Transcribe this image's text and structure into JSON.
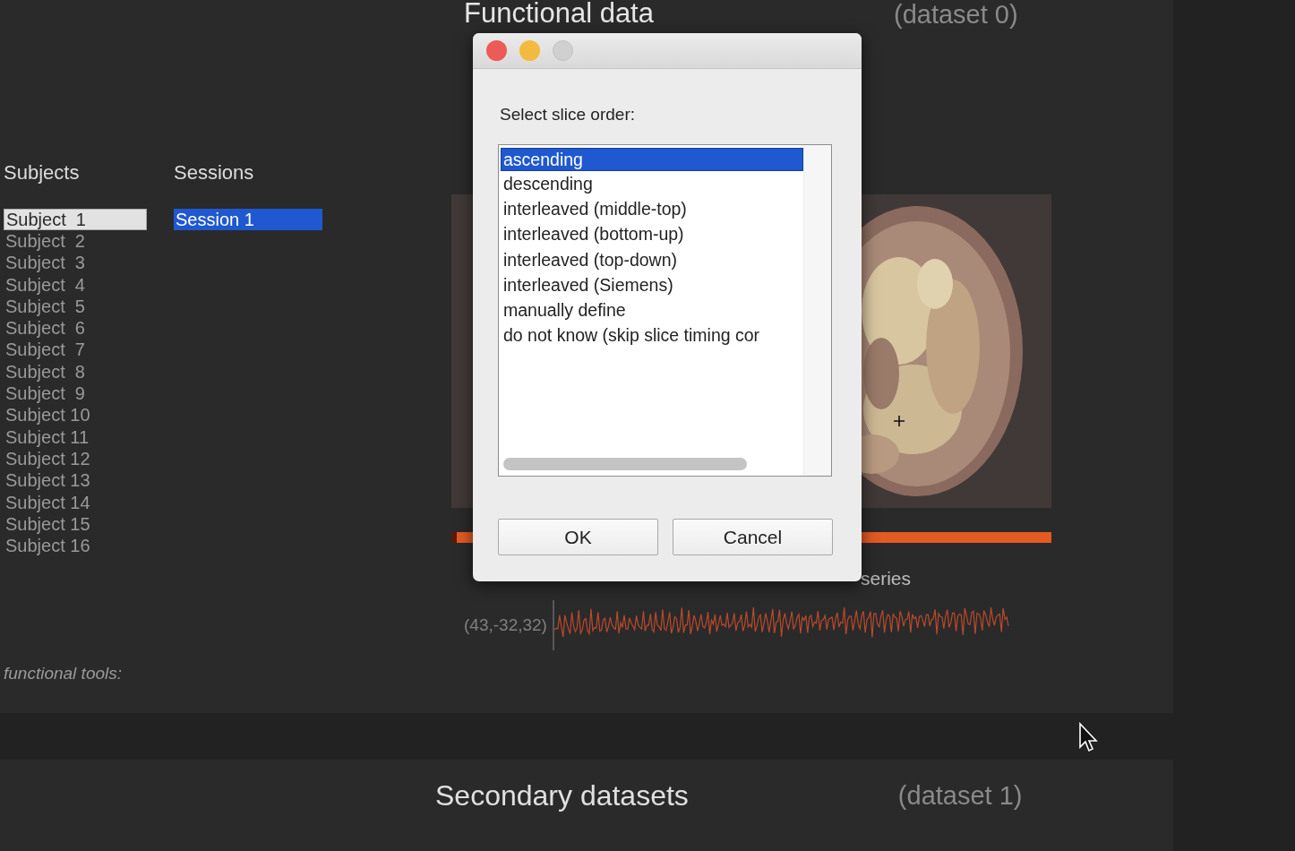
{
  "main_panel": {
    "title": "Functional data",
    "dataset": "(dataset 0)",
    "subjects": {
      "heading": "Subjects",
      "items": [
        {
          "label": "Subject  1",
          "selected": true
        },
        {
          "label": "Subject  2",
          "selected": false
        },
        {
          "label": "Subject  3",
          "selected": false
        },
        {
          "label": "Subject  4",
          "selected": false
        },
        {
          "label": "Subject  5",
          "selected": false
        },
        {
          "label": "Subject  6",
          "selected": false
        },
        {
          "label": "Subject  7",
          "selected": false
        },
        {
          "label": "Subject  8",
          "selected": false
        },
        {
          "label": "Subject  9",
          "selected": false
        },
        {
          "label": "Subject 10",
          "selected": false
        },
        {
          "label": "Subject 11",
          "selected": false
        },
        {
          "label": "Subject 12",
          "selected": false
        },
        {
          "label": "Subject 13",
          "selected": false
        },
        {
          "label": "Subject 14",
          "selected": false
        },
        {
          "label": "Subject 15",
          "selected": false
        },
        {
          "label": "Subject 16",
          "selected": false
        }
      ]
    },
    "sessions": {
      "heading": "Sessions",
      "items": [
        {
          "label": "Session 1",
          "selected": true
        }
      ]
    },
    "tools_label": "functional tools:",
    "viewer": {
      "timeseries_title": "series",
      "coordinates": "(43,-32,32)"
    }
  },
  "dialog": {
    "window_controls": [
      {
        "kind": "close",
        "disabled": false
      },
      {
        "kind": "minimize",
        "disabled": false
      },
      {
        "kind": "zoom",
        "disabled": true
      }
    ],
    "prompt": "Select slice order:",
    "options": [
      {
        "label": "ascending",
        "selected": true
      },
      {
        "label": "descending",
        "selected": false
      },
      {
        "label": "interleaved (middle-top)",
        "selected": false
      },
      {
        "label": "interleaved (bottom-up)",
        "selected": false
      },
      {
        "label": "interleaved (top-down)",
        "selected": false
      },
      {
        "label": "interleaved (Siemens)",
        "selected": false
      },
      {
        "label": "manually define",
        "selected": false
      },
      {
        "label": "do not know (skip slice timing cor",
        "selected": false
      }
    ],
    "buttons": [
      "OK",
      "Cancel"
    ]
  },
  "secondary_panel": {
    "title": "Secondary datasets",
    "dataset": "(dataset 1)"
  }
}
